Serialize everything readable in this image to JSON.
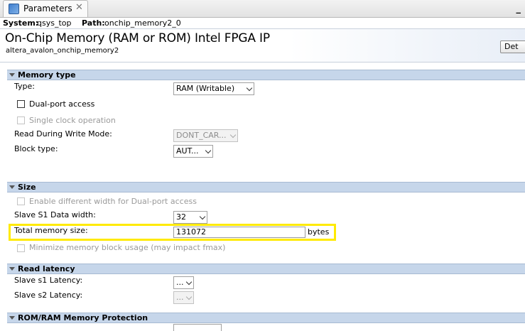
{
  "tab": {
    "label": "Parameters",
    "close": "✕"
  },
  "window": {
    "minimize": "_"
  },
  "pathbar": {
    "system_label": "System:",
    "system_value": "qsys_top",
    "path_label": "Path:",
    "path_value": "onchip_memory2_0"
  },
  "ip": {
    "title": "On-Chip Memory (RAM or ROM) Intel FPGA IP",
    "subtitle": "altera_avalon_onchip_memory2",
    "details_button": "Det"
  },
  "memory_type": {
    "header": "Memory type",
    "type_label": "Type:",
    "type_value": "RAM (Writable)",
    "dual_port_label": "Dual-port access",
    "single_clock_label": "Single clock operation",
    "rdw_label": "Read During Write Mode:",
    "rdw_value": "DONT_CAR...",
    "block_type_label": "Block type:",
    "block_type_value": "AUT..."
  },
  "size": {
    "header": "Size",
    "diff_width_label": "Enable different width for Dual-port access",
    "s1_width_label": "Slave S1 Data width:",
    "s1_width_value": "32",
    "total_label": "Total memory size:",
    "total_value": "131072",
    "total_unit": "bytes",
    "minimize_label": "Minimize memory block usage (may impact fmax)"
  },
  "read_latency": {
    "header": "Read latency",
    "s1_label": "Slave s1 Latency:",
    "s1_value": "...",
    "s2_label": "Slave s2 Latency:",
    "s2_value": "..."
  },
  "protection": {
    "header": "ROM/RAM Memory Protection"
  },
  "colors": {
    "highlight": "#ffea00",
    "section_bg": "#c6d6ea"
  }
}
